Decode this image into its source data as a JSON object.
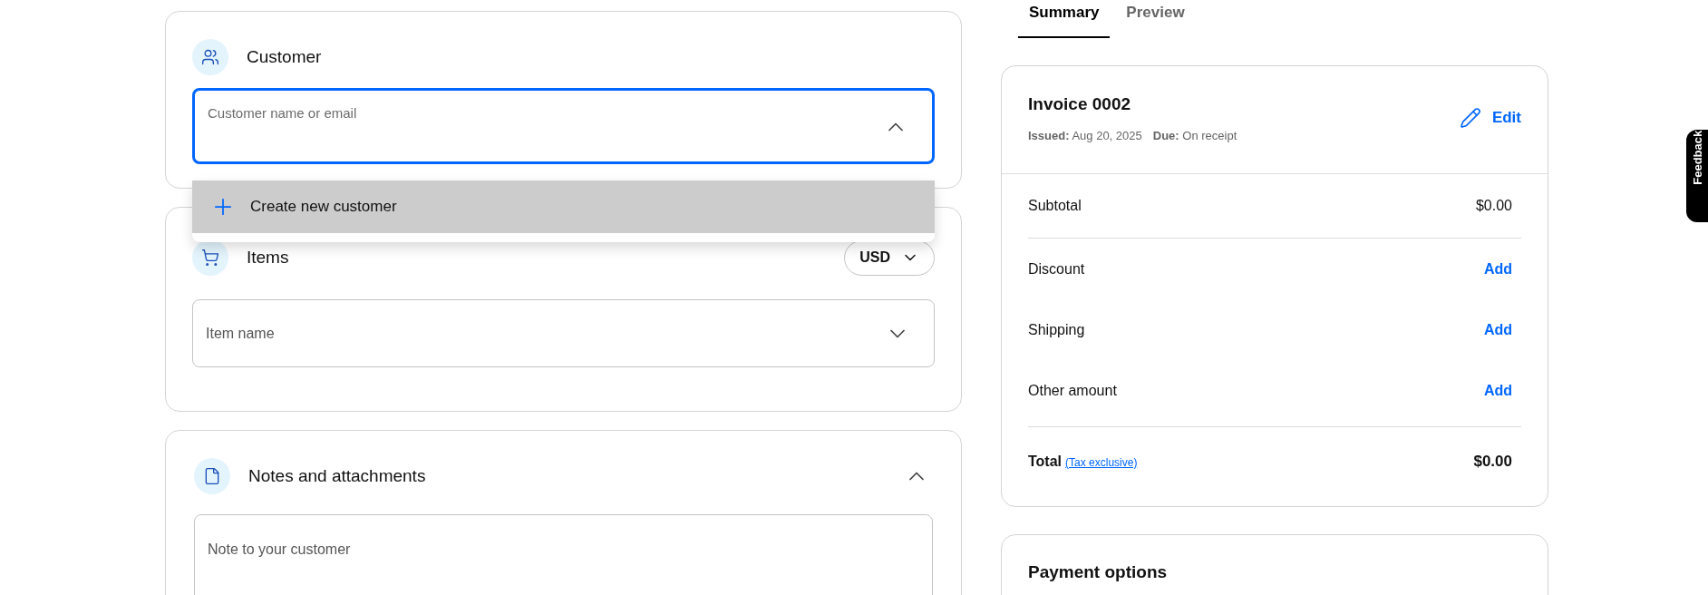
{
  "customer": {
    "title": "Customer",
    "field": {
      "placeholder": "Customer name or email",
      "expanded": true
    },
    "dropdown": [
      {
        "label": "Create new customer",
        "selected": true
      }
    ]
  },
  "items": {
    "title": "Items",
    "currency": "USD",
    "field": {
      "placeholder": "Item name",
      "expanded": false
    }
  },
  "notes": {
    "title": "Notes and attachments",
    "expanded": true,
    "field": {
      "placeholder": "Note to your customer"
    }
  },
  "tabs": [
    {
      "label": "Summary",
      "selected": true
    },
    {
      "label": "Preview",
      "selected": false
    }
  ],
  "invoice": {
    "title": "Invoice 0002",
    "issued_label": "Issued:",
    "issued": "Aug 20, 2025",
    "due_label": "Due:",
    "due": "On receipt",
    "edit": "Edit"
  },
  "summary_rows": [
    {
      "kind": "amount",
      "label": "Subtotal",
      "value": "$0.00"
    },
    {
      "kind": "action",
      "label": "Discount",
      "value": "Add"
    },
    {
      "kind": "action",
      "label": "Shipping",
      "value": "Add"
    },
    {
      "kind": "action",
      "label": "Other amount",
      "value": "Add"
    }
  ],
  "total": {
    "label": "Total",
    "link": "(Tax exclusive)",
    "value": "$0.00"
  },
  "payment": {
    "title": "Payment options"
  },
  "feedback": "Feedback"
}
